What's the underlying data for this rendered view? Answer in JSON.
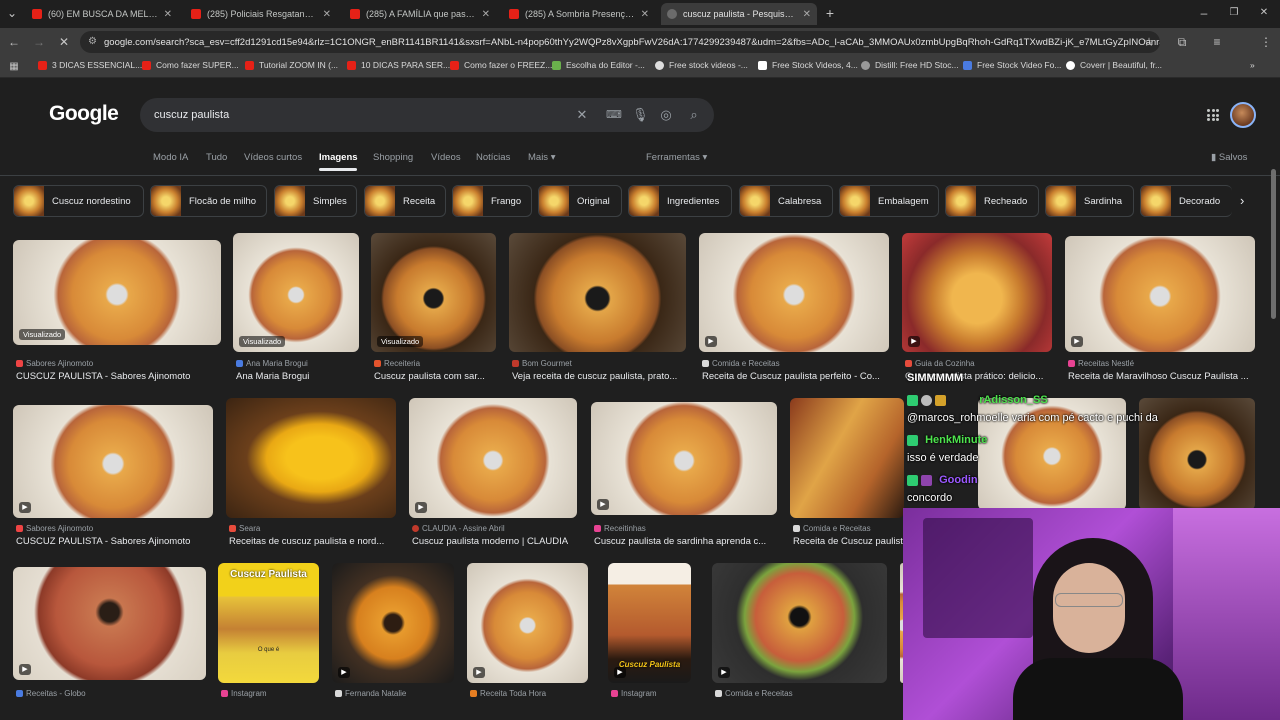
{
  "tabs": [
    {
      "label": "(60) EM BUSCA DA MELHOR CU",
      "icon": "youtube-icon"
    },
    {
      "label": "(285) Policiais Resgatando Hom",
      "icon": "youtube-icon"
    },
    {
      "label": "(285) A FAMÍLIA que passou de",
      "icon": "youtube-icon"
    },
    {
      "label": "(285) A Sombria Presença de S",
      "icon": "youtube-icon"
    },
    {
      "label": "cuscuz paulista - Pesquisa Goo",
      "icon": "google-icon"
    }
  ],
  "url": "google.com/search?sca_esv=cff2d1291cd15e94&rlz=1C1ONGR_enBR1141BR1141&sxsrf=ANbL-n4pop60thYy2WQPz8vXgpbFwV26dA:1774299239487&udm=2&fbs=ADc_l-aCAb_3MMOAUx0zmbUpgBqRhoh-GdRq1TXwdBZi-jK_e7MLtGyZpINOanr4p...",
  "bookmarks": [
    "3 DICAS ESSENCIAL...",
    "Como fazer SUPER...",
    "Tutorial ZOOM IN (...",
    "10 DICAS PARA SER...",
    "Como fazer o FREEZ...",
    "Escolha do Editor -...",
    "Free stock videos -...",
    "Free Stock Videos, 4...",
    "Distill: Free HD Stoc...",
    "Free Stock Video Fo...",
    "Coverr | Beautiful, fr..."
  ],
  "google_logo": "Google",
  "search_query": "cuscuz paulista",
  "nav": {
    "items": [
      "Modo IA",
      "Tudo",
      "Vídeos curtos",
      "Imagens",
      "Shopping",
      "Vídeos",
      "Notícias",
      "Mais"
    ],
    "active": "Imagens",
    "tools": "Ferramentas",
    "saved": "Salvos"
  },
  "chips": [
    "Cuscuz nordestino",
    "Flocão de milho",
    "Simples",
    "Receita",
    "Frango",
    "Original",
    "Ingredientes",
    "Calabresa",
    "Embalagem",
    "Recheado",
    "Sardinha",
    "Decorado"
  ],
  "results_row1": [
    {
      "source": "Sabores Ajinomoto",
      "title": "CUSCUZ PAULISTA - Sabores Ajinomoto",
      "badge": "Visualizado"
    },
    {
      "source": "Ana Maria Brogui",
      "title": "Ana Maria Brogui",
      "badge": "Visualizado"
    },
    {
      "source": "Receiteria",
      "title": "Cuscuz paulista com sar...",
      "badge": "Visualizado"
    },
    {
      "source": "Bom Gourmet",
      "title": "Veja receita de cuscuz paulista, prato...",
      "badge": ""
    },
    {
      "source": "Comida e Receitas",
      "title": "Receita de Cuscuz paulista perfeito - Co...",
      "badge": ""
    },
    {
      "source": "Guia da Cozinha",
      "title": "Cuscuz paulista prático: delicio...",
      "badge": ""
    },
    {
      "source": "Receitas Nestlé",
      "title": "Receita de Maravilhoso Cuscuz Paulista ...",
      "badge": ""
    }
  ],
  "results_row2": [
    {
      "source": "Sabores Ajinomoto",
      "title": "CUSCUZ PAULISTA - Sabores Ajinomoto"
    },
    {
      "source": "Seara",
      "title": "Receitas de cuscuz paulista e nord..."
    },
    {
      "source": "CLAUDIA - Assine Abril",
      "title": "Cuscuz paulista moderno | CLAUDIA"
    },
    {
      "source": "Receitinhas",
      "title": "Cuscuz paulista de sardinha aprenda c..."
    },
    {
      "source": "Comida e Receitas",
      "title": "Receita de Cuscuz paulist"
    }
  ],
  "results_row3_sources": [
    "Receitas - Globo",
    "Instagram",
    "Fernanda Natalie",
    "Receita Toda Hora",
    "Instagram",
    "Comida e Receitas"
  ],
  "poster_text": {
    "title": "Cuscuz Paulista",
    "caption": "O que é",
    "banner": "Cuscuz Paulista"
  },
  "stream_chat": [
    {
      "user": "",
      "msg": "SIMMMMM"
    },
    {
      "user": "rAdisson_SS",
      "msg": ""
    },
    {
      "user": "",
      "msg": "@marcos_rohmoelle varia com pé cacto e puchi da"
    },
    {
      "user": "HenkMinute",
      "msg": "isso é verdade"
    },
    {
      "user": "Goodin",
      "msg": "concordo"
    }
  ]
}
